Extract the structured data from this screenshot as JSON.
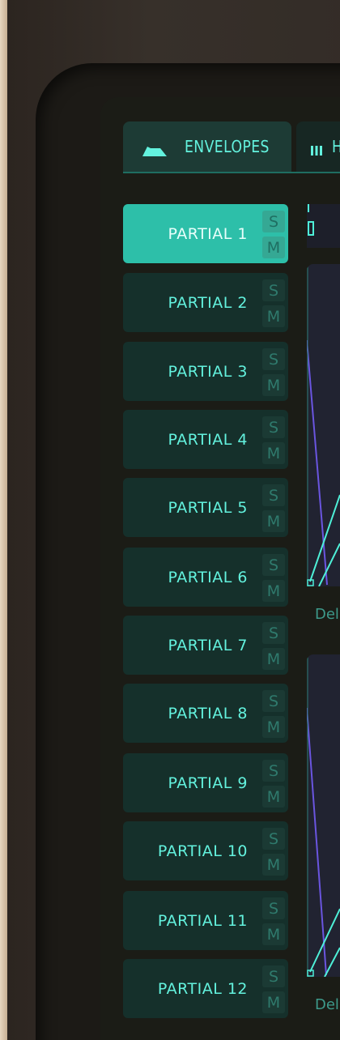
{
  "tabs": [
    {
      "label": "ENVELOPES",
      "icon": "envelope-shape-icon",
      "active": true
    },
    {
      "label": "H",
      "icon": "keyboard-icon",
      "active": false
    }
  ],
  "partials": [
    {
      "label": "PARTIAL 1",
      "solo": "S",
      "mute": "M",
      "selected": true
    },
    {
      "label": "PARTIAL 2",
      "solo": "S",
      "mute": "M",
      "selected": false
    },
    {
      "label": "PARTIAL 3",
      "solo": "S",
      "mute": "M",
      "selected": false
    },
    {
      "label": "PARTIAL 4",
      "solo": "S",
      "mute": "M",
      "selected": false
    },
    {
      "label": "PARTIAL 5",
      "solo": "S",
      "mute": "M",
      "selected": false
    },
    {
      "label": "PARTIAL 6",
      "solo": "S",
      "mute": "M",
      "selected": false
    },
    {
      "label": "PARTIAL 7",
      "solo": "S",
      "mute": "M",
      "selected": false
    },
    {
      "label": "PARTIAL 8",
      "solo": "S",
      "mute": "M",
      "selected": false
    },
    {
      "label": "PARTIAL 9",
      "solo": "S",
      "mute": "M",
      "selected": false
    },
    {
      "label": "PARTIAL 10",
      "solo": "S",
      "mute": "M",
      "selected": false
    },
    {
      "label": "PARTIAL 11",
      "solo": "S",
      "mute": "M",
      "selected": false
    },
    {
      "label": "PARTIAL 12",
      "solo": "S",
      "mute": "M",
      "selected": false
    }
  ],
  "envelopes": [
    {
      "caption": "Del"
    },
    {
      "caption": "Del"
    }
  ],
  "colors": {
    "accent": "#63f2de",
    "selected_bg": "#2dbfa9",
    "row_bg": "#15302b",
    "envelope_line_cyan": "#4ef0d8",
    "envelope_line_purple": "#6a55e0"
  }
}
